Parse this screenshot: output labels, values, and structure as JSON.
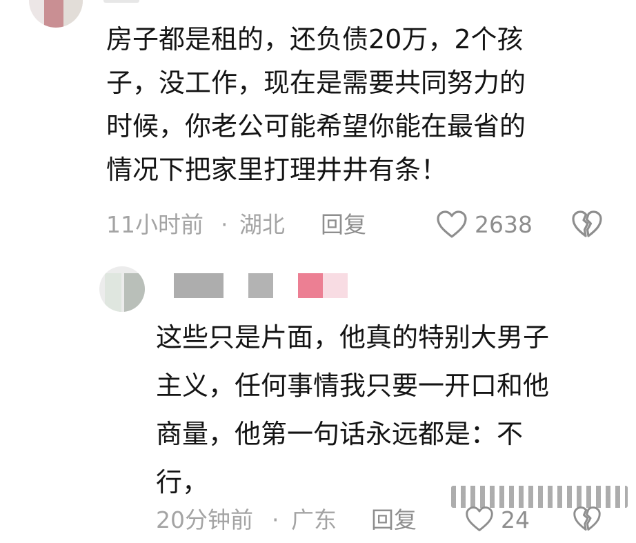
{
  "comment_1": {
    "lines": [
      "房子都是租的，还负债20万，2个孩",
      "子，没工作，现在是需要共同努力的",
      "时候，你老公可能希望你能在最省的",
      "情况下把家里打理井井有条！"
    ],
    "time": "11小时前",
    "separator": "·",
    "location": "湖北",
    "reply_label": "回复",
    "like_count": "2638",
    "like_icon": "heart-outline-icon",
    "dislike_icon": "broken-heart-icon"
  },
  "comment_2": {
    "lines": [
      "这些只是片面，他真的特别大男子",
      "主义，任何事情我只要一开口和他",
      "商量，他第一句话永远都是：不",
      "行，"
    ],
    "time": "20分钟前",
    "separator": "·",
    "location": "广东",
    "reply_label": "回复",
    "like_count": "24",
    "like_icon": "heart-outline-icon",
    "dislike_icon": "broken-heart-icon"
  },
  "colors": {
    "text_primary": "#141414",
    "text_meta": "#a4a4a4",
    "icon_gray": "#8e8e8e",
    "background": "#ffffff"
  }
}
